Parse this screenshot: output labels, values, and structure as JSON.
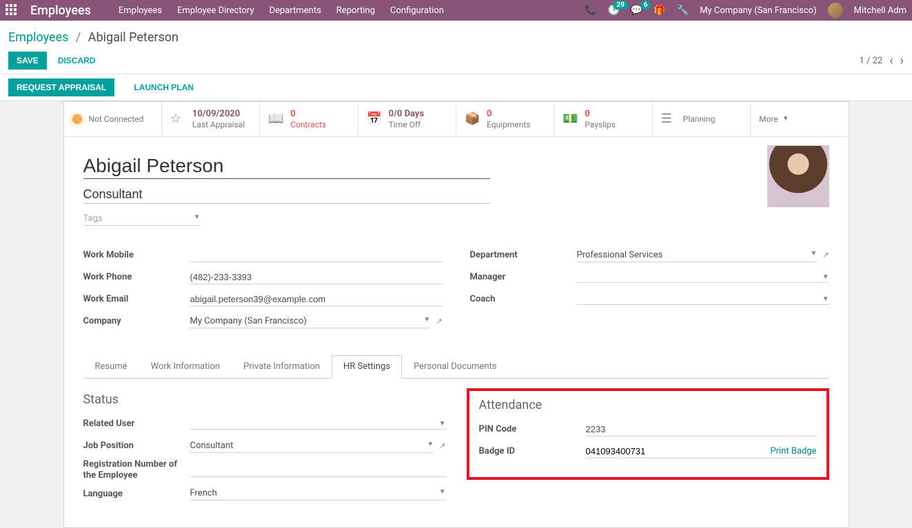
{
  "topbar": {
    "brand": "Employees",
    "menu": [
      "Employees",
      "Employee Directory",
      "Departments",
      "Reporting",
      "Configuration"
    ],
    "activities_count": "29",
    "messages_count": "6",
    "company": "My Company (San Francisco)",
    "user": "Mitchell Adm"
  },
  "breadcrumb": {
    "root": "Employees",
    "current": "Abigail Peterson"
  },
  "actions": {
    "save": "SAVE",
    "discard": "DISCARD",
    "request_appraisal": "REQUEST APPRAISAL",
    "launch_plan": "LAUNCH PLAN"
  },
  "pager": {
    "text": "1 / 22"
  },
  "stats": {
    "presence": "Not Connected",
    "appraisal_date": "10/09/2020",
    "appraisal_label": "Last Appraisal",
    "contracts_n": "0",
    "contracts_l": "Contracts",
    "timeoff_n": "0/0 Days",
    "timeoff_l": "Time Off",
    "equip_n": "0",
    "equip_l": "Equipments",
    "payslips_n": "0",
    "payslips_l": "Payslips",
    "planning": "Planning",
    "more": "More"
  },
  "employee": {
    "name": "Abigail Peterson",
    "title": "Consultant",
    "tags_placeholder": "Tags"
  },
  "fields": {
    "work_mobile_l": "Work Mobile",
    "work_mobile_v": "",
    "work_phone_l": "Work Phone",
    "work_phone_v": "(482)-233-3393",
    "work_email_l": "Work Email",
    "work_email_v": "abigail.peterson39@example.com",
    "company_l": "Company",
    "company_v": "My Company (San Francisco)",
    "department_l": "Department",
    "department_v": "Professional Services",
    "manager_l": "Manager",
    "manager_v": "",
    "coach_l": "Coach",
    "coach_v": ""
  },
  "tabs": [
    "Resumé",
    "Work Information",
    "Private Information",
    "HR Settings",
    "Personal Documents"
  ],
  "hr": {
    "status_title": "Status",
    "related_user_l": "Related User",
    "related_user_v": "",
    "job_position_l": "Job Position",
    "job_position_v": "Consultant",
    "reg_num_l": "Registration Number of the Employee",
    "reg_num_v": "",
    "language_l": "Language",
    "language_v": "French",
    "attendance_title": "Attendance",
    "pin_l": "PIN Code",
    "pin_v": "2233",
    "badge_l": "Badge ID",
    "badge_v": "041093400731",
    "print_badge": "Print Badge"
  }
}
